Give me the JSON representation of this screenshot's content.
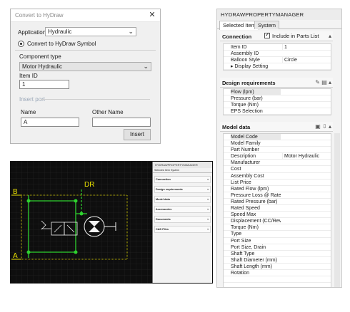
{
  "dialog": {
    "title": "Convert to HyDraw",
    "application_label": "Application",
    "application_value": "Hydraulic",
    "radio_label": "Convert to HyDraw Symbol",
    "component_type_label": "Component type",
    "component_type_value": "Motor Hydraulic",
    "item_id_label": "Item ID",
    "item_id_value": "1",
    "insert_port_label": "Insert port",
    "name_label": "Name",
    "name_value": "A",
    "other_name_label": "Other Name",
    "other_name_value": "",
    "insert_button": "Insert"
  },
  "property_manager": {
    "title": "HYDRAWPROPERTYMANAGER",
    "tabs": [
      "Selected Item",
      "System"
    ],
    "connection": {
      "title": "Connection",
      "include_label": "Include in Parts List",
      "rows": [
        {
          "k": "Item ID",
          "v": "1"
        },
        {
          "k": "Assembly ID",
          "v": ""
        },
        {
          "k": "Balloon Style",
          "v": "Circle"
        },
        {
          "k": "Display Setting",
          "v": ""
        }
      ]
    },
    "design": {
      "title": "Design requirements",
      "rows": [
        {
          "k": "Flow (lpm)",
          "v": ""
        },
        {
          "k": "Pressure (bar)",
          "v": ""
        },
        {
          "k": "Torque (Nm)",
          "v": ""
        },
        {
          "k": "EPS Selection",
          "v": ""
        }
      ]
    },
    "model": {
      "title": "Model data",
      "rows": [
        {
          "k": "Model Code",
          "v": ""
        },
        {
          "k": "Model Family",
          "v": ""
        },
        {
          "k": "Part Number",
          "v": ""
        },
        {
          "k": "Description",
          "v": "Motor Hydraulic"
        },
        {
          "k": "Manufacturer",
          "v": ""
        },
        {
          "k": "Cost",
          "v": ""
        },
        {
          "k": "Assembly Cost",
          "v": ""
        },
        {
          "k": "List Price",
          "v": ""
        },
        {
          "k": "Rated Flow (lpm)",
          "v": ""
        },
        {
          "k": "Pressure Loss @ Rate",
          "v": ""
        },
        {
          "k": "Rated Pressure (bar)",
          "v": ""
        },
        {
          "k": "Rated Speed",
          "v": ""
        },
        {
          "k": "Speed Max",
          "v": ""
        },
        {
          "k": "Displacement (CC/Rev",
          "v": ""
        },
        {
          "k": "Torque (Nm)",
          "v": ""
        },
        {
          "k": "Type",
          "v": ""
        },
        {
          "k": "Port Size",
          "v": ""
        },
        {
          "k": "Port Size, Drain",
          "v": ""
        },
        {
          "k": "Shaft Type",
          "v": ""
        },
        {
          "k": "Shaft Diameter (mm)",
          "v": ""
        },
        {
          "k": "Shaft Length (mm)",
          "v": ""
        },
        {
          "k": "Rotation",
          "v": ""
        },
        {
          "k": "",
          "v": ""
        }
      ]
    }
  },
  "cad": {
    "label_b": "B",
    "label_a": "A",
    "label_dr": "DR",
    "panel_title": "HYDRAWPROPERTYMANAGER",
    "panel_tabs": "Selected Item   System",
    "panel_sections": [
      "Connection",
      "Design requirements",
      "Model data",
      "Accessories",
      "Documents",
      "CAD Files"
    ]
  },
  "colors": {
    "cad_background": "#0e0e0e",
    "cad_yellow": "#e8e000",
    "cad_green": "#2fd22f",
    "cad_white": "#f2f2f2"
  }
}
